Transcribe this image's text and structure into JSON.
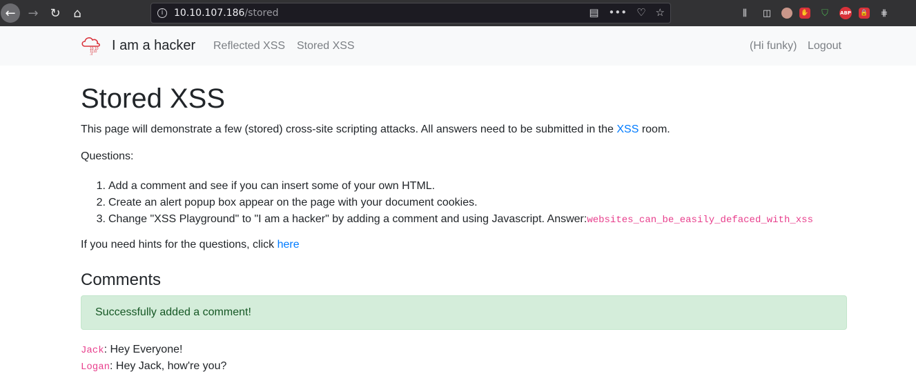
{
  "browser": {
    "url_host": "10.10.107.186",
    "url_path": "/stored"
  },
  "navbar": {
    "brand": "I am a hacker",
    "links": [
      "Reflected XSS",
      "Stored XSS"
    ],
    "user": "(Hi funky)",
    "logout": "Logout"
  },
  "main": {
    "title": "Stored XSS",
    "intro_before": "This page will demonstrate a few (stored) cross-site scripting attacks. All answers need to be submitted in the ",
    "intro_link": "XSS",
    "intro_after": " room.",
    "questions_label": "Questions:",
    "questions": [
      {
        "num": "1.",
        "text": "Add a comment and see if you can insert some of your own HTML."
      },
      {
        "num": "2.",
        "text": "Create an alert popup box appear on the page with your document cookies."
      },
      {
        "num": "3.",
        "text": "Change \"XSS Playground\" to \"I am a hacker\" by adding a comment and using Javascript. Answer: ",
        "answer": "websites_can_be_easily_defaced_with_xss"
      }
    ],
    "hints_text": "If you need hints for the questions, click ",
    "hints_link": "here",
    "comments_heading": "Comments",
    "success_alert": "Successfully added a comment!",
    "comments": [
      {
        "author": "Jack",
        "text": ": Hey Everyone!"
      },
      {
        "author": "Logan",
        "text": ": Hey Jack, how're you?"
      }
    ]
  },
  "colors": {
    "link": "#007bff",
    "code": "#e83e8c",
    "alert_bg": "#d4edda",
    "alert_text": "#155724"
  }
}
